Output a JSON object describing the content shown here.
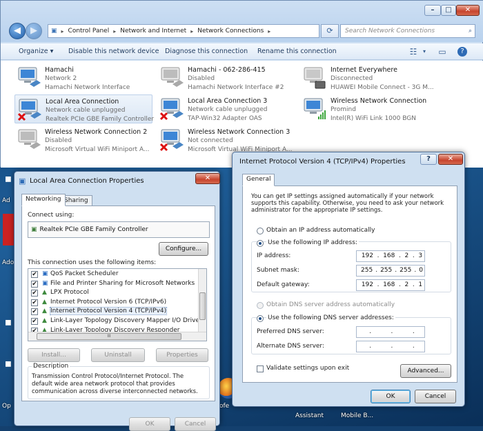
{
  "explorer": {
    "breadcrumb": [
      "Control Panel",
      "Network and Internet",
      "Network Connections"
    ],
    "search_placeholder": "Search Network Connections",
    "toolbar": [
      "Organize ▾",
      "Disable this network device",
      "Diagnose this connection",
      "Rename this connection"
    ],
    "connections": [
      {
        "name": "Hamachi",
        "status": "Network  2",
        "device": "Hamachi Network Interface",
        "state": "ok"
      },
      {
        "name": "Hamachi - 062-286-415",
        "status": "Disabled",
        "device": "Hamachi Network Interface #2",
        "state": "disabled"
      },
      {
        "name": "Internet Everywhere",
        "status": "Disconnected",
        "device": "HUAWEI Mobile Connect - 3G M...",
        "state": "modem"
      },
      {
        "name": "Local Area Connection",
        "status": "Network cable unplugged",
        "device": "Realtek PCIe GBE Family Controller",
        "state": "error"
      },
      {
        "name": "Local Area Connection 3",
        "status": "Network cable unplugged",
        "device": "TAP-Win32 Adapter OAS",
        "state": "error"
      },
      {
        "name": "Wireless Network Connection",
        "status": "Promind",
        "device": "Intel(R) WiFi Link 1000 BGN",
        "state": "wifi"
      },
      {
        "name": "Wireless Network Connection 2",
        "status": "Disabled",
        "device": "Microsoft Virtual WiFi Miniport A...",
        "state": "disabled"
      },
      {
        "name": "Wireless Network Connection 3",
        "status": "Not connected",
        "device": "Microsoft Virtual WiFi Miniport A...",
        "state": "error"
      }
    ]
  },
  "lac": {
    "title": "Local Area Connection Properties",
    "tabs": [
      "Networking",
      "Sharing"
    ],
    "connect_using_label": "Connect using:",
    "adapter": "Realtek PCIe GBE Family Controller",
    "configure": "Configure...",
    "items_label": "This connection uses the following items:",
    "items": [
      "QoS Packet Scheduler",
      "File and Printer Sharing for Microsoft Networks",
      "LPX Protocol",
      "Internet Protocol Version 6 (TCP/IPv6)",
      "Internet Protocol Version 4 (TCP/IPv4)",
      "Link-Layer Topology Discovery Mapper I/O Driver",
      "Link-Layer Topology Discovery Responder"
    ],
    "scroll_grip": "III",
    "install": "Install...",
    "uninstall": "Uninstall",
    "properties": "Properties",
    "description_label": "Description",
    "description": "Transmission Control Protocol/Internet Protocol. The default wide area network protocol that provides communication across diverse interconnected networks.",
    "ok": "OK",
    "cancel": "Cancel"
  },
  "ipv4": {
    "title": "Internet Protocol Version 4 (TCP/IPv4) Properties",
    "help": "?",
    "tab": "General",
    "intro": "You can get IP settings assigned automatically if your network supports this capability. Otherwise, you need to ask your network administrator for the appropriate IP settings.",
    "obtain_ip": "Obtain an IP address automatically",
    "use_ip": "Use the following IP address:",
    "ip_label": "IP address:",
    "ip_value": [
      "192",
      "168",
      "2",
      "3"
    ],
    "mask_label": "Subnet mask:",
    "mask_value": [
      "255",
      "255",
      "255",
      "0"
    ],
    "gw_label": "Default gateway:",
    "gw_value": [
      "192",
      "168",
      "2",
      "1"
    ],
    "obtain_dns": "Obtain DNS server address automatically",
    "use_dns": "Use the following DNS server addresses:",
    "pref_dns": "Preferred DNS server:",
    "alt_dns": "Alternate DNS server:",
    "validate": "Validate settings upon exit",
    "advanced": "Advanced...",
    "ok": "OK",
    "cancel": "Cancel"
  },
  "desktop": {
    "labels": [
      "Ad",
      "Ado",
      "Op",
      "Assistant",
      "Mobile B..."
    ],
    "partial": "ofe"
  }
}
